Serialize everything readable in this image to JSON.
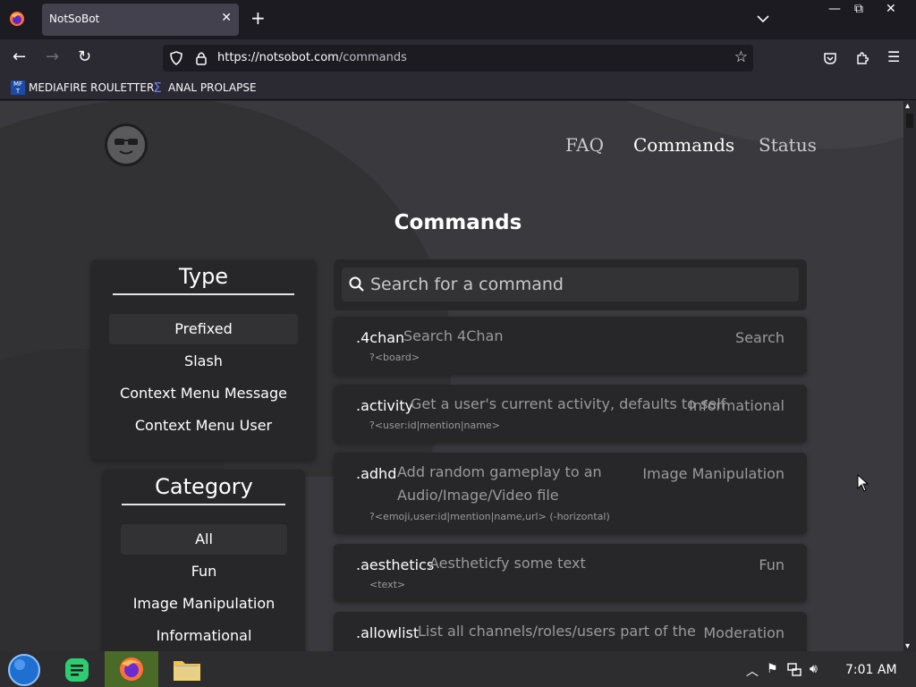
{
  "browser": {
    "tab_title": "NotSoBot",
    "url_host": "https://notsobot.com",
    "url_path": "/commands",
    "bookmarks": [
      {
        "label": "MEDIAFIRE ROULETTER",
        "icon": "mediafire-icon"
      },
      {
        "label": "ANAL PROLAPSE",
        "icon": "sigma-icon"
      }
    ]
  },
  "site": {
    "nav": [
      "FAQ",
      "Commands",
      "Status"
    ],
    "page_title": "Commands"
  },
  "type_panel": {
    "heading": "Type",
    "items": [
      "Prefixed",
      "Slash",
      "Context Menu Message",
      "Context Menu User"
    ],
    "selected": "Prefixed"
  },
  "category_panel": {
    "heading": "Category",
    "items": [
      "All",
      "Fun",
      "Image Manipulation",
      "Informational"
    ],
    "selected": "All"
  },
  "search": {
    "placeholder": "Search for a command"
  },
  "commands": [
    {
      "name": ".4chan",
      "desc": "Search 4Chan",
      "desc2": "",
      "category": "Search",
      "usage": "?<board>"
    },
    {
      "name": ".activity",
      "desc": "Get a user's current activity, defaults to self",
      "desc2": "",
      "category": "Informational",
      "usage": "?<user:id|mention|name>"
    },
    {
      "name": ".adhd",
      "desc": "Add random gameplay to an",
      "desc2": "Audio/Image/Video file",
      "category": "Image Manipulation",
      "usage": "?<emoji,user:id|mention|name,url> (-horizontal)"
    },
    {
      "name": ".aesthetics",
      "desc": "Aestheticfy some text",
      "desc2": "",
      "category": "Fun",
      "usage": "<text>"
    },
    {
      "name": ".allowlist",
      "desc": "List all channels/roles/users part of the",
      "desc2": "",
      "category": "Moderation",
      "usage": ""
    }
  ],
  "taskbar": {
    "apps": [
      "start-orb-icon",
      "notes-app-icon",
      "firefox-icon",
      "file-manager-icon"
    ],
    "clock": "7:01 AM"
  }
}
